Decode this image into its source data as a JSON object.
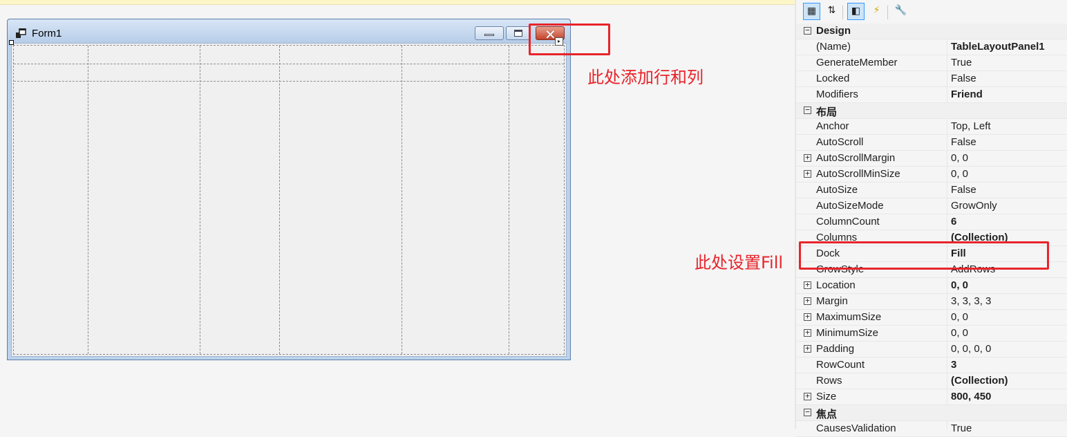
{
  "form": {
    "title": "Form1"
  },
  "annotations": {
    "note1": "此处添加行和列",
    "note2": "此处设置Fill"
  },
  "property_grid": {
    "toolbar": [
      {
        "icon": "categorized-icon",
        "glyph": "▦"
      },
      {
        "icon": "alphabetical-icon",
        "glyph": "⇅"
      },
      {
        "icon": "properties-icon",
        "glyph": "◧"
      },
      {
        "icon": "events-icon",
        "glyph": "⚡"
      },
      {
        "icon": "property-pages-icon",
        "glyph": "🔧"
      }
    ],
    "rows": [
      {
        "cat": true,
        "name": "Design",
        "exp": "−"
      },
      {
        "name": "(Name)",
        "value": "TableLayoutPanel1",
        "bold": true
      },
      {
        "name": "GenerateMember",
        "value": "True"
      },
      {
        "name": "Locked",
        "value": "False"
      },
      {
        "name": "Modifiers",
        "value": "Friend",
        "bold": true
      },
      {
        "cat": true,
        "name": "布局",
        "exp": "−"
      },
      {
        "name": "Anchor",
        "value": "Top, Left"
      },
      {
        "name": "AutoScroll",
        "value": "False"
      },
      {
        "name": "AutoScrollMargin",
        "value": "0, 0",
        "exp": "+"
      },
      {
        "name": "AutoScrollMinSize",
        "value": "0, 0",
        "exp": "+"
      },
      {
        "name": "AutoSize",
        "value": "False"
      },
      {
        "name": "AutoSizeMode",
        "value": "GrowOnly"
      },
      {
        "name": "ColumnCount",
        "value": "6",
        "bold": true
      },
      {
        "name": "Columns",
        "value": "(Collection)",
        "bold": true
      },
      {
        "name": "Dock",
        "value": "Fill",
        "bold": true
      },
      {
        "name": "GrowStyle",
        "value": "AddRows"
      },
      {
        "name": "Location",
        "value": "0, 0",
        "bold": true,
        "exp": "+"
      },
      {
        "name": "Margin",
        "value": "3, 3, 3, 3",
        "exp": "+"
      },
      {
        "name": "MaximumSize",
        "value": "0, 0",
        "exp": "+"
      },
      {
        "name": "MinimumSize",
        "value": "0, 0",
        "exp": "+"
      },
      {
        "name": "Padding",
        "value": "0, 0, 0, 0",
        "exp": "+"
      },
      {
        "name": "RowCount",
        "value": "3",
        "bold": true
      },
      {
        "name": "Rows",
        "value": "(Collection)",
        "bold": true
      },
      {
        "name": "Size",
        "value": "800, 450",
        "bold": true,
        "exp": "+"
      },
      {
        "cat": true,
        "name": "焦点",
        "exp": "−"
      },
      {
        "name": "CausesValidation",
        "value": "True"
      }
    ]
  }
}
